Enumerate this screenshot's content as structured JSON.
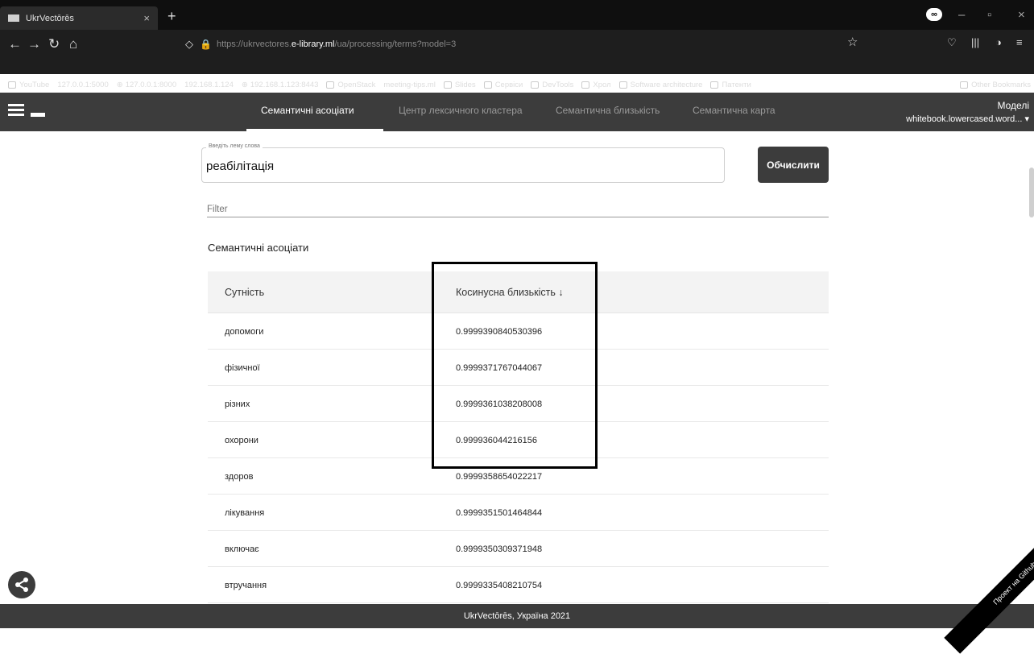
{
  "browser": {
    "tab_title": "UkrVectōrēs",
    "tab_close": "×",
    "new_tab": "+",
    "url_prefix": "https://ukrvectores.",
    "url_host": "e-library.ml",
    "url_path": "/ua/processing/terms?model=3",
    "bookmarks": [
      "YouTube",
      "127.0.0.1:5000",
      "127.0.0.1:8000",
      "192.168.1.124",
      "192.168.1.123:8443",
      "OpenStack",
      "meeting-tips.ml",
      "Slides",
      "Сервіси",
      "DevTools",
      "Хрол",
      "Software architecture",
      "Патенти"
    ],
    "other_bookmarks": "Other Bookmarks"
  },
  "app": {
    "tabs": [
      "Семантичні асоціати",
      "Центр лексичного кластера",
      "Семантична близькість",
      "Семантична карта"
    ],
    "models_label": "Моделі",
    "models_value": "whitebook.lowercased.word... ▾"
  },
  "form": {
    "lemma_legend": "Введіть лему слова",
    "lemma_value": "реабілітація",
    "compute_label": "Обчислити",
    "filter_placeholder": "Filter"
  },
  "results": {
    "title": "Семантичні асоціати",
    "col_entity": "Сутність",
    "col_cosine": "Косинусна близькість ↓",
    "rows": [
      {
        "entity": "допомоги",
        "score": "0.9999390840530396"
      },
      {
        "entity": "фізичної",
        "score": "0.9999371767044067"
      },
      {
        "entity": "різних",
        "score": "0.9999361038208008"
      },
      {
        "entity": "охорони",
        "score": "0.999936044216156"
      },
      {
        "entity": "здоров",
        "score": "0.9999358654022217"
      },
      {
        "entity": "лікування",
        "score": "0.9999351501464844"
      },
      {
        "entity": "включає",
        "score": "0.9999350309371948"
      },
      {
        "entity": "втручання",
        "score": "0.9999335408210754"
      }
    ]
  },
  "footer": {
    "text": "UkrVectōrēs, Україна 2021"
  },
  "ribbon": {
    "text": "Проект на Github"
  }
}
